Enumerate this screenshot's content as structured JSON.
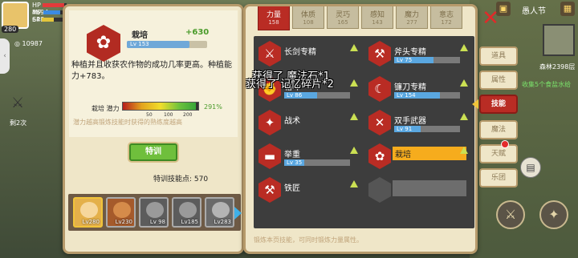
{
  "status": {
    "hp_label": "HP",
    "hp_value": "4694",
    "mp_label": "MP",
    "mp_value": "648",
    "sp_label": "SP",
    "level": "280",
    "currency": "10987",
    "round_label": "剩2次",
    "colors": {
      "hp": "#e33b3b",
      "mp": "#3b8be3",
      "sp": "#e3c53b"
    }
  },
  "header": {
    "date": "愚人节",
    "forest_label": "森林2398层",
    "quest_label": "收集5个食盐水给"
  },
  "detail": {
    "title": "栽培",
    "bonus": "+630",
    "level_text": "Lv 153",
    "level_progress": 0.78,
    "description": "种植并且收获农作物的成功几率更高。种植能力+783。",
    "potential_label": "栽培 潜力",
    "potential_pct": "291%",
    "potential_fill": 0.97,
    "ticks": [
      "50",
      "100",
      "200"
    ],
    "note": "潜力越高锻炼技能时获得的熟练度越高",
    "train_label": "特训",
    "points_label": "特训技能点:",
    "points_value": "570"
  },
  "characters": [
    {
      "level": "Lv280",
      "ring": "#f1c43a",
      "bg": "#e4b04a",
      "face": "#f6d79c"
    },
    {
      "level": "Lv230",
      "ring": "#aaa",
      "bg": "#a55a2b",
      "face": "#d58b4a"
    },
    {
      "level": "Lv 98",
      "ring": "#aaa",
      "bg": "#5c5c5c",
      "face": "#9a9a9a"
    },
    {
      "level": "Lv185",
      "ring": "#aaa",
      "bg": "#5c5c5c",
      "face": "#9a9a9a"
    },
    {
      "level": "Lv283",
      "ring": "#aaa",
      "bg": "#6a6a6a",
      "face": "#b4b4b4"
    }
  ],
  "tabs": [
    {
      "label": "力量",
      "value": "158",
      "active": true
    },
    {
      "label": "体质",
      "value": "108",
      "active": false
    },
    {
      "label": "灵巧",
      "value": "165",
      "active": false
    },
    {
      "label": "感知",
      "value": "143",
      "active": false
    },
    {
      "label": "魔力",
      "value": "277",
      "active": false
    },
    {
      "label": "意志",
      "value": "172",
      "active": false
    }
  ],
  "skills": [
    {
      "name": "长剑专精",
      "icon": "sword-icon",
      "glyph": "⚔",
      "level_text": "",
      "progress": 0.0,
      "state": "normal"
    },
    {
      "name": "斧头专精",
      "icon": "axe-icon",
      "glyph": "🪓",
      "level_text": "Lv 75",
      "progress": 0.6,
      "state": "normal"
    },
    {
      "name": "格斗",
      "icon": "fist-icon",
      "glyph": "✊",
      "level_text": "Lv 86",
      "progress": 0.5,
      "state": "normal"
    },
    {
      "name": "镰刀专精",
      "icon": "scythe-icon",
      "glyph": "☾",
      "level_text": "Lv 154",
      "progress": 0.7,
      "state": "normal"
    },
    {
      "name": "战术",
      "icon": "tactics-icon",
      "glyph": "✦",
      "level_text": "",
      "progress": 0.0,
      "state": "normal"
    },
    {
      "name": "双手武器",
      "icon": "two-handed-icon",
      "glyph": "✕",
      "level_text": "Lv 91",
      "progress": 0.4,
      "state": "normal"
    },
    {
      "name": "举重",
      "icon": "dumbbell-icon",
      "glyph": "▬",
      "level_text": "Lv 35",
      "progress": 0.3,
      "state": "normal"
    },
    {
      "name": "栽培",
      "icon": "plant-icon",
      "glyph": "✿",
      "level_text": "",
      "progress": 0.0,
      "state": "selected"
    },
    {
      "name": "铁匠",
      "icon": "anvil-icon",
      "glyph": "⚒",
      "level_text": "",
      "progress": 0.0,
      "state": "normal"
    },
    {
      "name": "",
      "icon": "locked-skill-icon",
      "glyph": "",
      "level_text": "",
      "progress": 0.0,
      "state": "empty"
    }
  ],
  "floating": {
    "line1": "获得了 魔法石*1",
    "line2": "获得了 记忆碎片*2"
  },
  "footer_note": "锻炼本页技能，可同时锻炼力量属性。",
  "menu": [
    {
      "label": "道具",
      "active": false
    },
    {
      "label": "属性",
      "active": false
    },
    {
      "label": "技能",
      "active": true
    },
    {
      "label": "魔法",
      "active": false
    },
    {
      "label": "天赋",
      "active": false
    },
    {
      "label": "乐团",
      "active": false
    }
  ]
}
